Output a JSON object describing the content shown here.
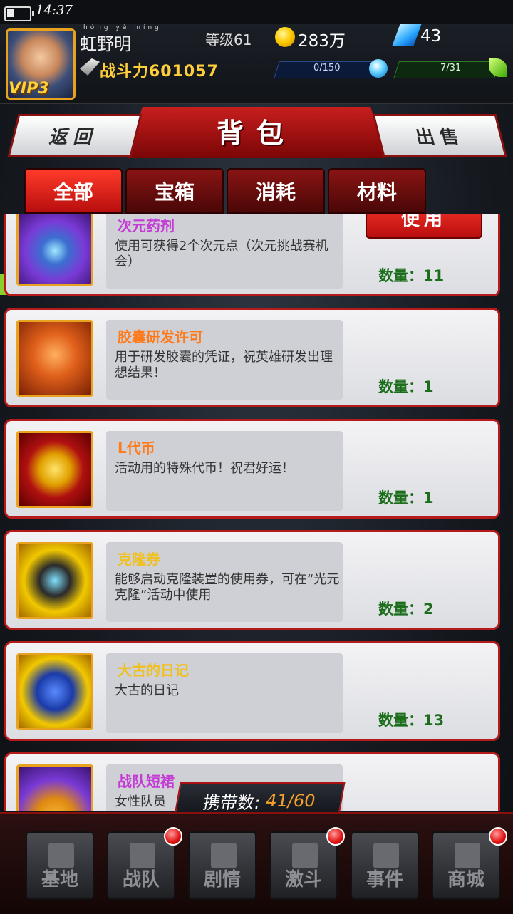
{
  "status": {
    "time": "14:37"
  },
  "player": {
    "name_pinyin": "hóng yě míng",
    "name": "虹野明",
    "vip": "VIP3",
    "level": "等级61",
    "gold": "283万",
    "gems": "43",
    "power": "战斗力601057",
    "exp": "0/150",
    "stamina": "7/31"
  },
  "header": {
    "title": "背包",
    "back_label": "返回",
    "sell_label": "出售"
  },
  "tabs": [
    {
      "label": "全部",
      "active": true
    },
    {
      "label": "宝箱"
    },
    {
      "label": "消耗"
    },
    {
      "label": "材料"
    }
  ],
  "items": [
    {
      "name": "次元药剂",
      "name_color": "#c43bd6",
      "desc": "使用可获得2个次元点（次元挑战赛机会）",
      "qty": "数量：11",
      "use": "使用",
      "icon_color": "#6a2cc4"
    },
    {
      "name": "胶囊研发许可",
      "name_color": "#ff7a1a",
      "desc": "用于研发胶囊的凭证，祝英雄研发出理想结果！",
      "qty": "数量：1",
      "icon_color": "#d04a10"
    },
    {
      "name": "L代币",
      "name_color": "#ff7a1a",
      "desc": "活动用的特殊代币！祝君好运！",
      "qty": "数量：1",
      "icon_color": "#b01010"
    },
    {
      "name": "克隆券",
      "name_color": "#f0c020",
      "desc": "能够启动克隆装置的使用券，可在“光元克隆”活动中使用",
      "qty": "数量：2",
      "icon_color": "#e0a000"
    },
    {
      "name": "大古的日记",
      "name_color": "#f0c020",
      "desc": "大古的日记",
      "qty": "数量：13",
      "icon_color": "#e0a000"
    },
    {
      "name": "战队短裙",
      "name_color": "#c43bd6",
      "desc": "女性队员",
      "icon_color": "#6a2cc4"
    }
  ],
  "carry": {
    "label": "携带数:",
    "value": "41/60"
  },
  "nav": [
    {
      "label": "基地",
      "dot": false
    },
    {
      "label": "战队",
      "dot": true
    },
    {
      "label": "剧情",
      "dot": false
    },
    {
      "label": "激斗",
      "dot": true
    },
    {
      "label": "事件",
      "dot": false
    },
    {
      "label": "商城",
      "dot": true
    }
  ]
}
